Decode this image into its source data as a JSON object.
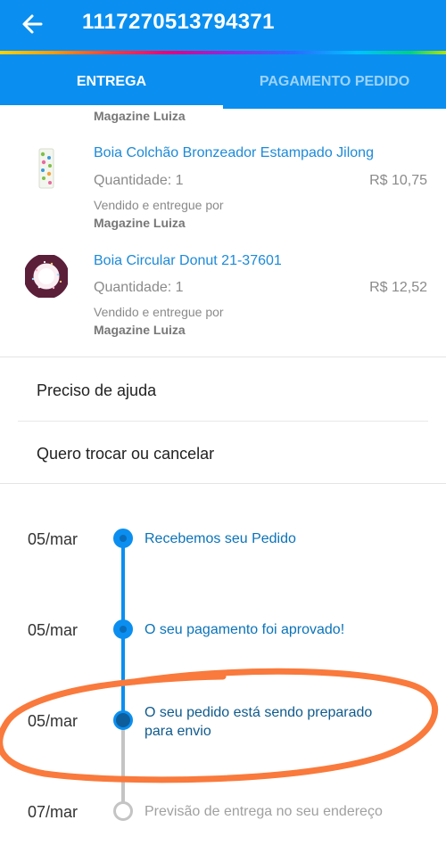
{
  "header": {
    "back_icon": "arrow-left-icon",
    "order_id": "1117270513794371"
  },
  "tabs": [
    {
      "label": "ENTREGA",
      "active": true
    },
    {
      "label": "PAGAMENTO PEDIDO",
      "active": false
    }
  ],
  "partial_item": {
    "seller": "Magazine Luiza"
  },
  "items": [
    {
      "title": "Boia Colchão Bronzeador Estampado Jilong",
      "quantity": "Quantidade: 1",
      "price": "R$ 10,75",
      "sold_by": "Vendido e entregue por",
      "seller": "Magazine Luiza"
    },
    {
      "title": "Boia Circular Donut 21-37601",
      "quantity": "Quantidade: 1",
      "price": "R$ 12,52",
      "sold_by": "Vendido e entregue por",
      "seller": "Magazine Luiza"
    }
  ],
  "actions": {
    "help": "Preciso de ajuda",
    "exchange": "Quero trocar ou cancelar"
  },
  "timeline": [
    {
      "date": "05/mar",
      "text": "Recebemos seu Pedido",
      "status": "done"
    },
    {
      "date": "05/mar",
      "text": "O seu pagamento foi aprovado!",
      "status": "done"
    },
    {
      "date": "05/mar",
      "text_line1": "O seu pedido está sendo preparado",
      "text_line2": "para envio",
      "status": "current"
    },
    {
      "date": "07/mar",
      "text": "Previsão de entrega no seu endereço",
      "status": "pending"
    }
  ],
  "colors": {
    "primary": "#0a8ff0",
    "link": "#1c8ad8",
    "annotation": "#f97a3c"
  }
}
